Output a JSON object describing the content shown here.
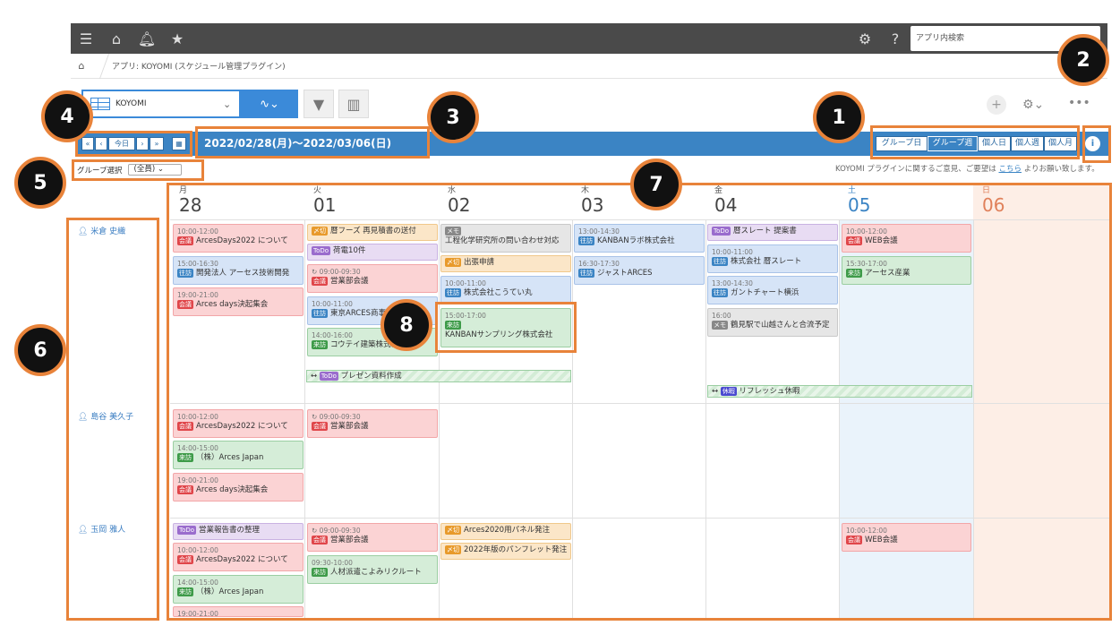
{
  "topbar": {
    "search_placeholder": "アプリ内検索"
  },
  "breadcrumb": {
    "app": "アプリ: KOYOMI (スケジュール管理プラグイン)"
  },
  "toolbar": {
    "view_name": "KOYOMI",
    "view_arrow": "⌄"
  },
  "nav": {
    "prev_week": "«",
    "prev_day": "‹",
    "today": "今日",
    "next_day": "›",
    "next_week": "»",
    "date_range": "2022/02/28(月)～2022/03/06(日)",
    "views": [
      "グループ日",
      "グループ週",
      "個人日",
      "個人週",
      "個人月"
    ],
    "info": "i"
  },
  "group": {
    "label": "グループ選択",
    "value": "(全員)"
  },
  "feedback": {
    "prefix": "KOYOMI プラグインに関するご意見、ご要望は ",
    "link": "こちら",
    "suffix": " よりお願い致します。"
  },
  "callouts": [
    "1",
    "2",
    "3",
    "4",
    "5",
    "6",
    "7",
    "8"
  ],
  "days": [
    {
      "dow": "月",
      "num": "28"
    },
    {
      "dow": "火",
      "num": "01"
    },
    {
      "dow": "水",
      "num": "02"
    },
    {
      "dow": "木",
      "num": "03"
    },
    {
      "dow": "金",
      "num": "04"
    },
    {
      "dow": "土",
      "num": "05"
    },
    {
      "dow": "日",
      "num": "06"
    }
  ],
  "users": [
    "米倉 史織",
    "島谷 美久子",
    "玉岡 雅人"
  ],
  "colors": {
    "accent": "#3b84c4",
    "callout_border": "#e8833a",
    "sat_bg": "#eaf3fb",
    "sun_bg": "#fdeee6"
  },
  "events": {
    "e1": {
      "time": "10:00-12:00",
      "tag": "会議",
      "title": "ArcesDays2022 について"
    },
    "e2": {
      "time": "15:00-16:30",
      "tag": "往訪",
      "title": "開発法人 アーセス技術開発"
    },
    "e3": {
      "time": "19:00-21:00",
      "tag": "会議",
      "title": "Arces days決起集会"
    },
    "e4": {
      "tag": "〆切",
      "title": "暦フーズ 再見積書の送付"
    },
    "e5": {
      "tag": "ToDo",
      "title": "荷電10件"
    },
    "e6": {
      "time": "09:00-09:30",
      "tag": "会議",
      "title": "営業部会議"
    },
    "e7": {
      "time": "10:00-11:00",
      "tag": "往訪",
      "title": "東京ARCES商事"
    },
    "e8": {
      "time": "14:00-16:00",
      "tag": "来訪",
      "title": "コウテイ建築株式会社"
    },
    "e9": {
      "tag": "メモ",
      "title": "工程化学研究所の問い合わせ対応"
    },
    "e10": {
      "tag": "〆切",
      "title": "出張申請"
    },
    "e11": {
      "time": "10:00-11:00",
      "tag": "往訪",
      "title": "株式会社こうてい丸"
    },
    "e12": {
      "time": "15:00-17:00",
      "tag": "来訪",
      "title": "KANBANサンプリング株式会社"
    },
    "e13": {
      "time": "13:00-14:30",
      "tag": "往訪",
      "title": "KANBANラボ株式会社"
    },
    "e14": {
      "time": "16:30-17:30",
      "tag": "往訪",
      "title": "ジャストARCES"
    },
    "e15": {
      "tag": "ToDo",
      "title": "暦スレート 提案書"
    },
    "e16": {
      "time": "10:00-11:00",
      "tag": "往訪",
      "title": "株式会社 暦スレート"
    },
    "e17": {
      "time": "13:00-14:30",
      "tag": "往訪",
      "title": "ガントチャート横浜"
    },
    "e18": {
      "time": "16:00",
      "tag": "メモ",
      "title": "鶴見駅で山越さんと合流予定"
    },
    "e19": {
      "time": "10:00-12:00",
      "tag": "会議",
      "title": "WEB会議"
    },
    "e20": {
      "time": "15:30-17:00",
      "tag": "来訪",
      "title": "アーセス産業"
    },
    "s1": {
      "tag": "ToDo",
      "title": "プレゼン資料作成"
    },
    "s2": {
      "tag": "休暇",
      "title": "リフレッシュ休暇"
    },
    "u2e1": {
      "time": "10:00-12:00",
      "tag": "会議",
      "title": "ArcesDays2022 について"
    },
    "u2e2": {
      "time": "14:00-15:00",
      "tag": "来訪",
      "title": "（株）Arces Japan"
    },
    "u2e3": {
      "time": "19:00-21:00",
      "tag": "会議",
      "title": "Arces days決起集会"
    },
    "u2e4": {
      "time": "09:00-09:30",
      "tag": "会議",
      "title": "営業部会議"
    },
    "u3e1": {
      "tag": "ToDo",
      "title": "営業報告書の整理"
    },
    "u3e2": {
      "time": "10:00-12:00",
      "tag": "会議",
      "title": "ArcesDays2022 について"
    },
    "u3e3": {
      "time": "14:00-15:00",
      "tag": "来訪",
      "title": "（株）Arces Japan"
    },
    "u3e4": {
      "time": "19:00-21:00"
    },
    "u3e5": {
      "time": "09:00-09:30",
      "tag": "会議",
      "title": "営業部会議"
    },
    "u3e6": {
      "time": "09:30-10:00",
      "tag": "来訪",
      "title": "人材派遣こよみリクルート"
    },
    "u3e7": {
      "tag": "〆切",
      "title": "Arces2020用パネル発注"
    },
    "u3e8": {
      "tag": "〆切",
      "title": "2022年版のパンフレット発注"
    },
    "u3e9": {
      "time": "10:00-12:00",
      "tag": "会議",
      "title": "WEB会議"
    }
  }
}
